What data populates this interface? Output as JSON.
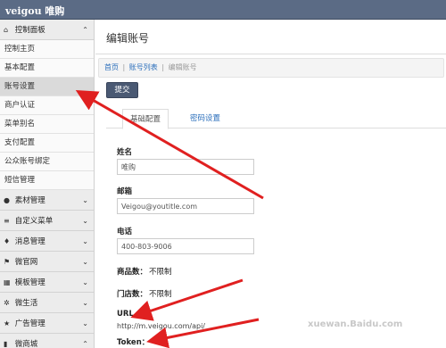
{
  "app": {
    "title": "veigou 唯购"
  },
  "sidebar": {
    "control_panel": {
      "label": "控制面板",
      "icon": "home-icon",
      "items": [
        {
          "label": "控制主页",
          "active": false
        },
        {
          "label": "基本配置",
          "active": false
        },
        {
          "label": "账号设置",
          "active": true
        },
        {
          "label": "商户认证",
          "active": false
        },
        {
          "label": "菜单别名",
          "active": false
        },
        {
          "label": "支付配置",
          "active": false
        },
        {
          "label": "公众账号绑定",
          "active": false
        },
        {
          "label": "短信管理",
          "active": false
        }
      ]
    },
    "sections": [
      {
        "label": "素材管理",
        "icon": "comment-icon"
      },
      {
        "label": "自定义菜单",
        "icon": "list-icon"
      },
      {
        "label": "消息管理",
        "icon": "pin-icon"
      },
      {
        "label": "微官网",
        "icon": "flag-icon"
      },
      {
        "label": "模板管理",
        "icon": "grid-icon"
      },
      {
        "label": "微生活",
        "icon": "gear-icon"
      },
      {
        "label": "广告管理",
        "icon": "star-icon"
      },
      {
        "label": "微商城",
        "icon": "chart-icon"
      }
    ]
  },
  "main": {
    "title": "编辑账号",
    "breadcrumb": [
      "首页",
      "账号列表",
      "编辑账号"
    ],
    "submit_label": "提交",
    "tabs": [
      {
        "label": "基础配置",
        "active": true
      },
      {
        "label": "密码设置",
        "active": false
      }
    ],
    "form": {
      "name": {
        "label": "姓名",
        "value": "唯购"
      },
      "email": {
        "label": "邮箱",
        "value": "Veigou@youtitle.com"
      },
      "phone": {
        "label": "电话",
        "value": "400-803-9006"
      },
      "goods_count": {
        "label": "商品数：",
        "value": "不限制"
      },
      "store_count": {
        "label": "门店数：",
        "value": "不限制"
      },
      "url": {
        "label": "URL",
        "value": "http://m.veigou.com/api/"
      },
      "token": {
        "label": "Token："
      }
    }
  },
  "watermark": "xuewan.Baidu.com",
  "colors": {
    "topbar": "#5b6b85",
    "link": "#2a6ebb",
    "arrow": "#e02020",
    "submit": "#4a5973"
  }
}
